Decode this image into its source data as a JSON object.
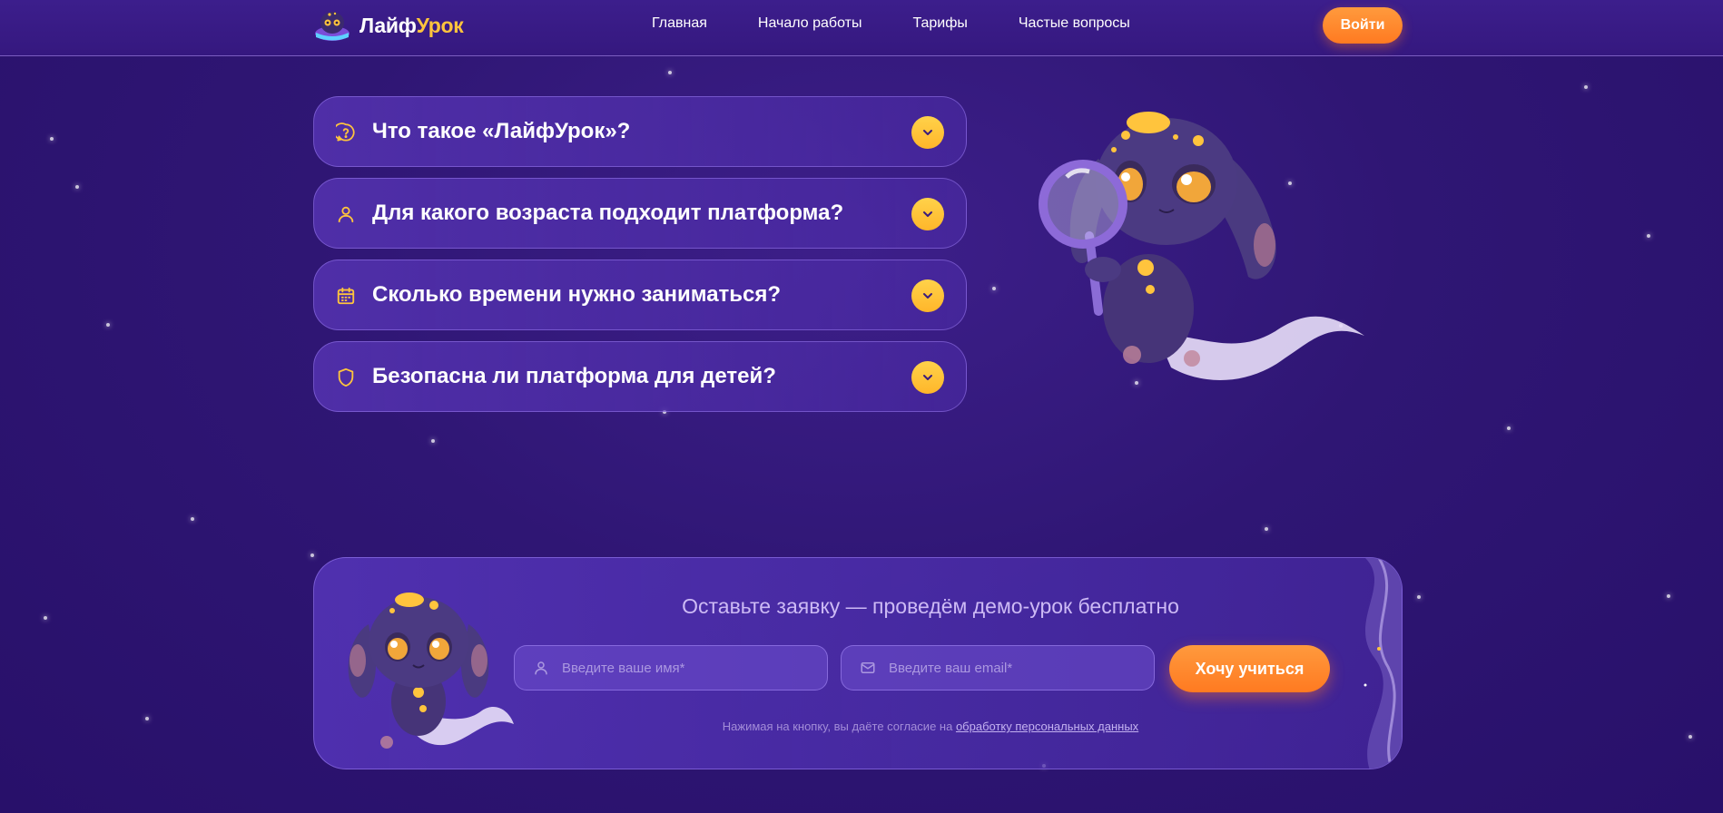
{
  "header": {
    "logo": {
      "part1": "Лайф",
      "part2": "Урок"
    },
    "nav": [
      "Главная",
      "Начало работы",
      "Тарифы",
      "Частые вопросы"
    ],
    "login_label": "Войти"
  },
  "faq": {
    "items": [
      {
        "icon": "question-bubble-icon",
        "question": "Что такое «ЛайфУрок»?"
      },
      {
        "icon": "user-icon",
        "question": "Для какого возраста подходит платформа?"
      },
      {
        "icon": "calendar-icon",
        "question": "Сколько времени нужно заниматься?"
      },
      {
        "icon": "shield-icon",
        "question": "Безопасна ли платформа для детей?"
      }
    ]
  },
  "lead_form": {
    "title": "Оставьте заявку — проведём демо-урок бесплатно",
    "name_placeholder": "Введите ваше имя*",
    "email_placeholder": "Введите ваш email*",
    "submit_label": "Хочу учиться",
    "consent_text": "Нажимая на кнопку, вы даёте согласие на",
    "consent_link": "обработку персональных данных"
  },
  "colors": {
    "background": "#2f1674",
    "accent_orange": "#ff8a2b",
    "accent_yellow": "#ffc43d"
  }
}
